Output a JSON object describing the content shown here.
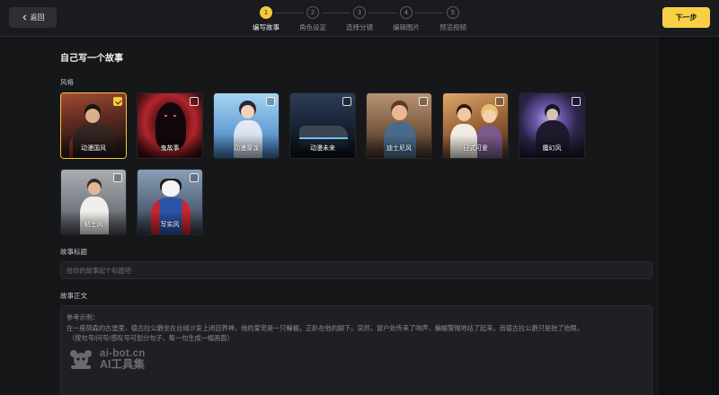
{
  "header": {
    "back_label": "返回",
    "back_icon": "chevron-left-icon",
    "next_label": "下一步",
    "steps": [
      {
        "num": "1",
        "label": "编写故事",
        "active": true
      },
      {
        "num": "2",
        "label": "角色设定",
        "active": false
      },
      {
        "num": "3",
        "label": "选择分镜",
        "active": false
      },
      {
        "num": "4",
        "label": "编辑图片",
        "active": false
      },
      {
        "num": "5",
        "label": "预览视频",
        "active": false
      }
    ]
  },
  "main": {
    "title": "自己写一个故事",
    "style_label": "风格",
    "styles": [
      {
        "label": "动漫国风",
        "selected": true
      },
      {
        "label": "鬼故事",
        "selected": false
      },
      {
        "label": "动漫厚涂",
        "selected": false
      },
      {
        "label": "动漫未来",
        "selected": false
      },
      {
        "label": "迪士尼风",
        "selected": false
      },
      {
        "label": "日式可爱",
        "selected": false
      },
      {
        "label": "魔幻风",
        "selected": false
      },
      {
        "label": "粘土风",
        "selected": false
      },
      {
        "label": "写实风",
        "selected": false
      }
    ],
    "story_title_label": "故事标题",
    "story_title_value": "",
    "story_title_placeholder": "给你的故事起个标题吧",
    "story_body_label": "故事正文",
    "story_body_placeholder": {
      "heading": "参考示例：",
      "example": "在一座阴森的古堡里，德古拉公爵坐在丝绒沙发上闭目养神，他的爱宠是一只蝙蝠，正趴在他的脚下。突然，窗户处传来了响声，蝙蝠警惕地站了起来，而德古拉公爵只是抬了抬眼。",
      "hint": "（按句号/问号/感叹号可划分句子，每一句生成一幅画面）"
    }
  },
  "watermark": {
    "domain": "ai-bot.cn",
    "name": "AI工具集",
    "icon": "ai-bot-logo-icon"
  },
  "colors": {
    "accent": "#f5c93a",
    "next_button": "#f7d046",
    "background": "#161719",
    "header": "#1a1b1f",
    "input_background": "#1f2024"
  }
}
